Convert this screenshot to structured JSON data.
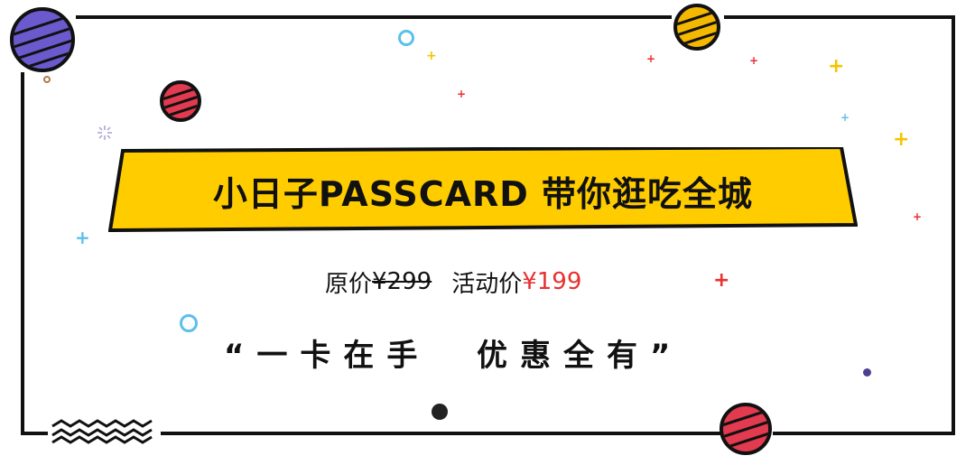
{
  "banner": {
    "title": "小日子PASSCARD 带你逛吃全城"
  },
  "price": {
    "original_label": "原价",
    "original_value": "¥299",
    "promo_label": "活动价",
    "promo_value": "¥199"
  },
  "slogan": {
    "text": "“一卡在手  优惠全有”"
  },
  "colors": {
    "banner_yellow": "#ffcc00",
    "price_red": "#e8302f",
    "frame": "#111111",
    "planet_purple": "#6a5acd",
    "planet_yellow": "#f5b800",
    "planet_red": "#e23a4e",
    "accent_blue": "#5bc0eb"
  },
  "carousel": {
    "active_index": 1,
    "total": 1
  }
}
